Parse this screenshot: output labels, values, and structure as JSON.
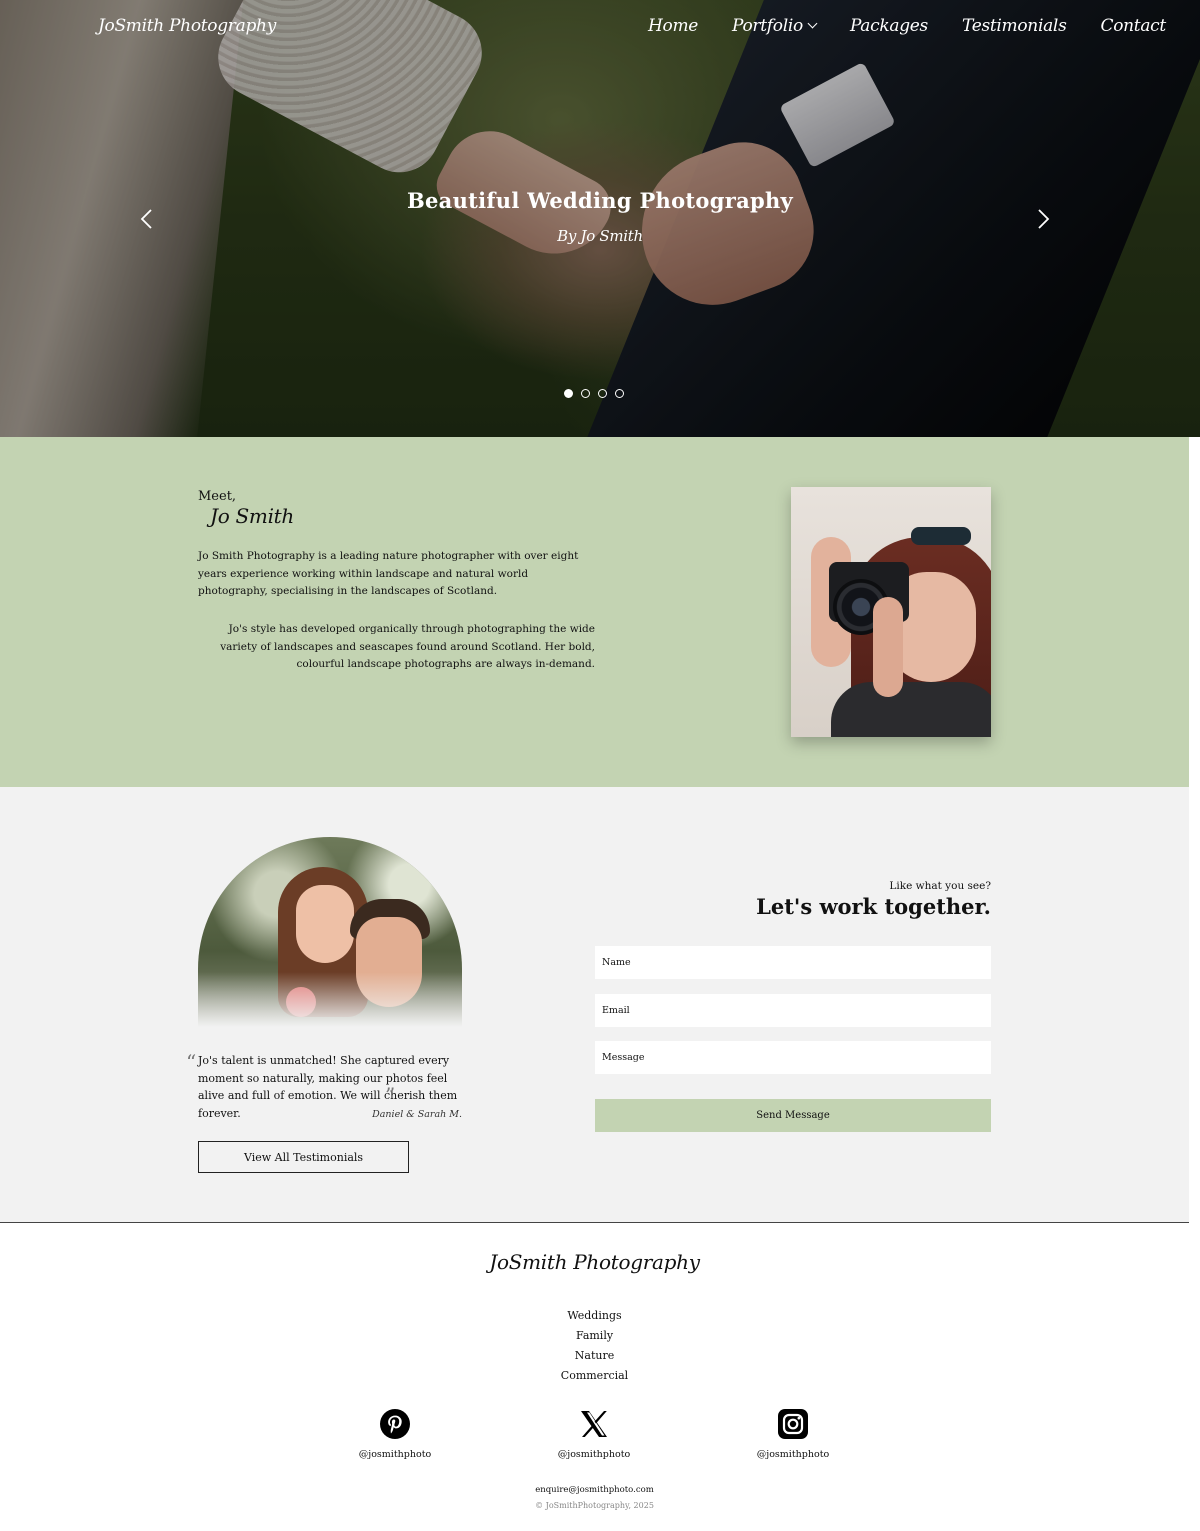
{
  "header": {
    "logo": "JoSmith Photography",
    "nav": [
      {
        "label": "Home"
      },
      {
        "label": "Portfolio",
        "has_dropdown": true
      },
      {
        "label": "Packages"
      },
      {
        "label": "Testimonials"
      },
      {
        "label": "Contact"
      }
    ]
  },
  "hero": {
    "title": "Beautiful Wedding Photography",
    "subtitle": "By Jo Smith",
    "slide_count": 4,
    "active_slide": 1,
    "icons": {
      "prev": "chevron-left-icon",
      "next": "chevron-right-icon"
    }
  },
  "about": {
    "greeting": "Meet,",
    "name": "Jo Smith",
    "paragraph1": "Jo Smith Photography is a leading nature photographer with over eight years experience working within landscape and natural world photography, specialising in the landscapes of Scotland.",
    "paragraph2": "Jo's style has developed organically through photographing the wide variety of landscapes and seascapes found around Scotland. Her bold, colourful landscape photographs are always in-demand.",
    "background_color": "#c3d3b2"
  },
  "testimonial": {
    "open_quote": "“",
    "text": "Jo's talent is unmatched! She captured every moment so naturally, making our photos feel alive and full of emotion. We will cherish them forever.",
    "close_quote": "”",
    "author": "Daniel & Sarah M.",
    "button_label": "View All Testimonials"
  },
  "contact": {
    "kicker": "Like what you see?",
    "heading": "Let's work together.",
    "name_placeholder": "Name",
    "email_placeholder": "Email",
    "message_placeholder": "Message",
    "send_label": "Send Message",
    "accent_color": "#c3d3b2"
  },
  "footer": {
    "logo": "JoSmith Photography",
    "links": [
      "Weddings",
      "Family",
      "Nature",
      "Commercial"
    ],
    "social": [
      {
        "icon": "pinterest-icon",
        "handle": "@josmithphoto"
      },
      {
        "icon": "x-icon",
        "handle": "@josmithphoto"
      },
      {
        "icon": "instagram-icon",
        "handle": "@josmithphoto"
      }
    ],
    "email": "enquire@josmithphoto.com",
    "copyright": "© JoSmithPhotography, 2025"
  }
}
